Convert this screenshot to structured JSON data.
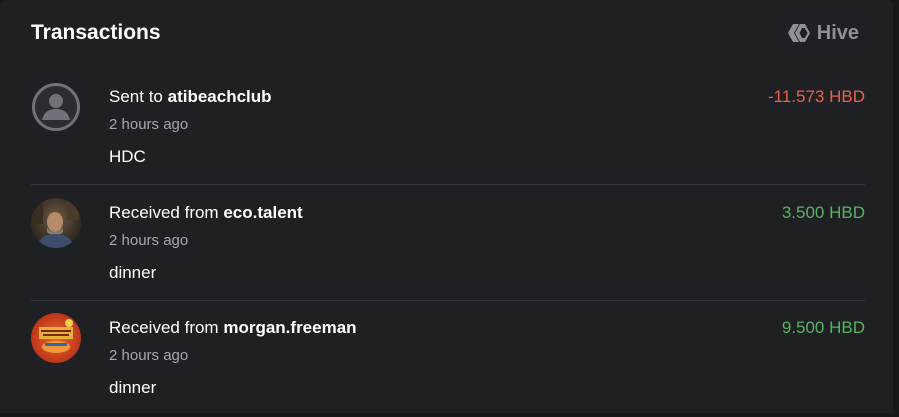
{
  "header": {
    "title": "Transactions",
    "brand_label": "Hive",
    "brand_icon": "hive-logo-icon"
  },
  "colors": {
    "negative": "#e8604c",
    "positive": "#58b361",
    "card_bg": "#1f2024"
  },
  "transactions": [
    {
      "direction_text": "Sent to",
      "user": "atibeachclub",
      "time": "2 hours ago",
      "memo": "HDC",
      "amount": "-11.573 HBD",
      "avatar": "default-user-avatar-icon"
    },
    {
      "direction_text": "Received from",
      "user": "eco.talent",
      "time": "2 hours ago",
      "memo": "dinner",
      "amount": "3.500 HBD",
      "avatar": "user-photo-avatar"
    },
    {
      "direction_text": "Received from",
      "user": "morgan.freeman",
      "time": "2 hours ago",
      "memo": "dinner",
      "amount": "9.500 HBD",
      "avatar": "user-photo-avatar"
    }
  ]
}
